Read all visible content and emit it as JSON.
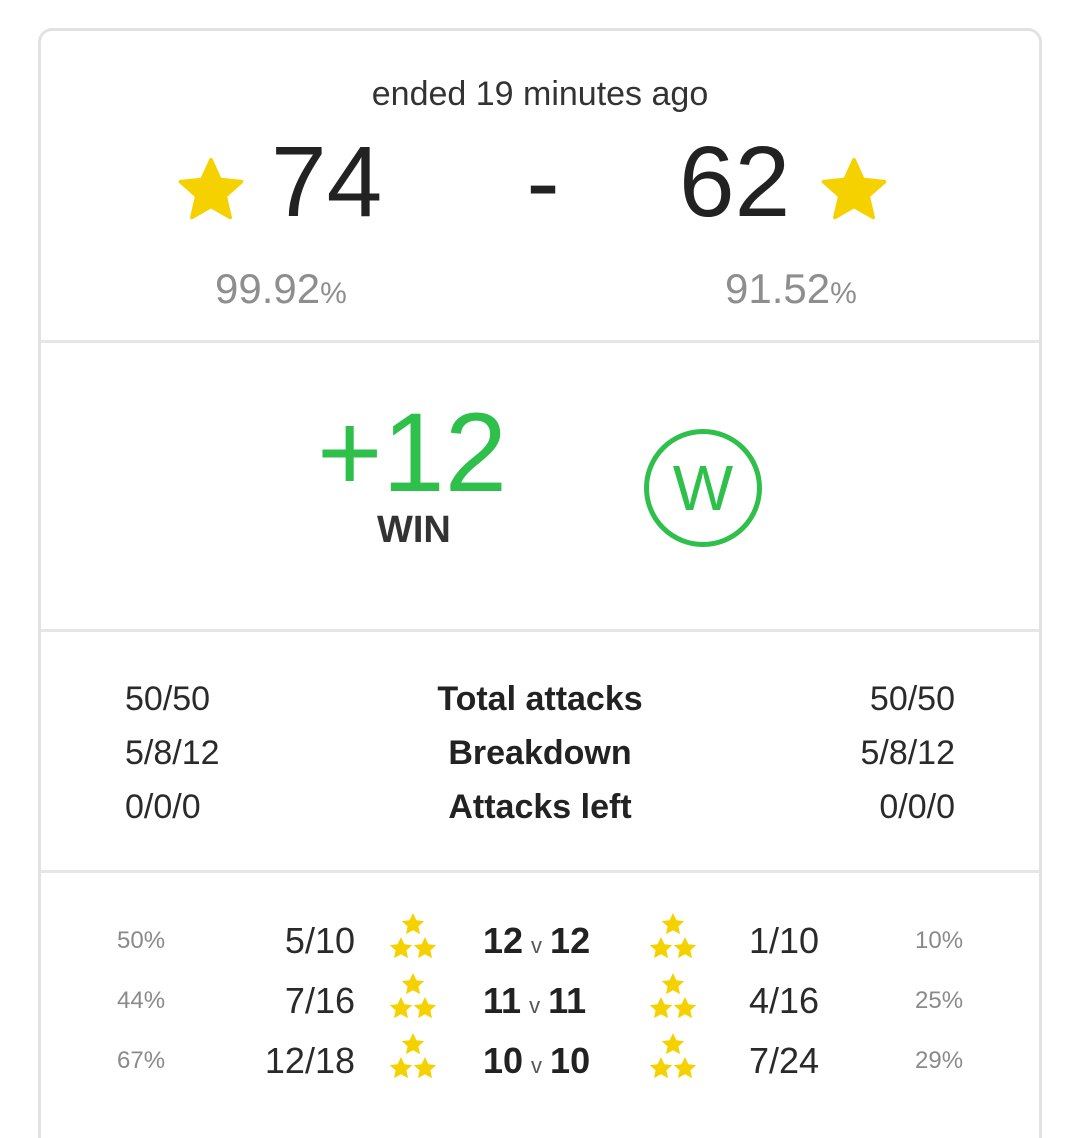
{
  "header": {
    "ended_text": "ended 19 minutes ago"
  },
  "score": {
    "left_stars": "74",
    "separator": "-",
    "right_stars": "62",
    "left_destruction": "99.92",
    "right_destruction": "91.52",
    "percent_symbol": "%",
    "star_icon": "star-icon",
    "star_color": "#f5d100"
  },
  "result": {
    "difference": "+12",
    "label": "WIN",
    "badge_letter": "W",
    "badge_icon": "win-badge-icon",
    "accent_color": "#2fbf4b"
  },
  "stats": [
    {
      "left": "50/50",
      "label": "Total attacks",
      "right": "50/50"
    },
    {
      "left": "5/8/12",
      "label": "Breakdown",
      "right": "5/8/12"
    },
    {
      "left": "0/0/0",
      "label": "Attacks left",
      "right": "0/0/0"
    }
  ],
  "townhall_rows": [
    {
      "left_rate": "50",
      "left_frac": "5/10",
      "left_th": "12",
      "vs": "v",
      "right_th": "12",
      "right_frac": "1/10",
      "right_rate": "10"
    },
    {
      "left_rate": "44",
      "left_frac": "7/16",
      "left_th": "11",
      "vs": "v",
      "right_th": "11",
      "right_frac": "4/16",
      "right_rate": "25"
    },
    {
      "left_rate": "67",
      "left_frac": "12/18",
      "left_th": "10",
      "vs": "v",
      "right_th": "10",
      "right_frac": "7/24",
      "right_rate": "29"
    }
  ],
  "row_icon": "three-stars-icon",
  "percent_symbol": "%"
}
